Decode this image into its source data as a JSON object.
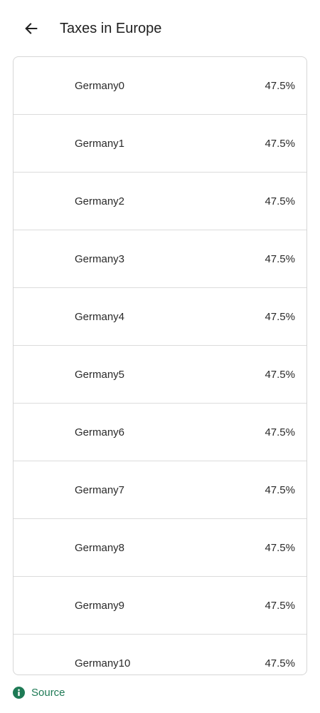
{
  "header": {
    "title": "Taxes in Europe",
    "back_icon": "arrow-left-icon"
  },
  "rows": [
    {
      "country": "Germany0",
      "rate": "47.5%"
    },
    {
      "country": "Germany1",
      "rate": "47.5%"
    },
    {
      "country": "Germany2",
      "rate": "47.5%"
    },
    {
      "country": "Germany3",
      "rate": "47.5%"
    },
    {
      "country": "Germany4",
      "rate": "47.5%"
    },
    {
      "country": "Germany5",
      "rate": "47.5%"
    },
    {
      "country": "Germany6",
      "rate": "47.5%"
    },
    {
      "country": "Germany7",
      "rate": "47.5%"
    },
    {
      "country": "Germany8",
      "rate": "47.5%"
    },
    {
      "country": "Germany9",
      "rate": "47.5%"
    },
    {
      "country": "Germany10",
      "rate": "47.5%"
    }
  ],
  "footer": {
    "source_label": "Source",
    "source_icon": "info-icon"
  },
  "colors": {
    "accent": "#1e7a55",
    "text": "#212121",
    "divider": "#dcdcdc"
  }
}
